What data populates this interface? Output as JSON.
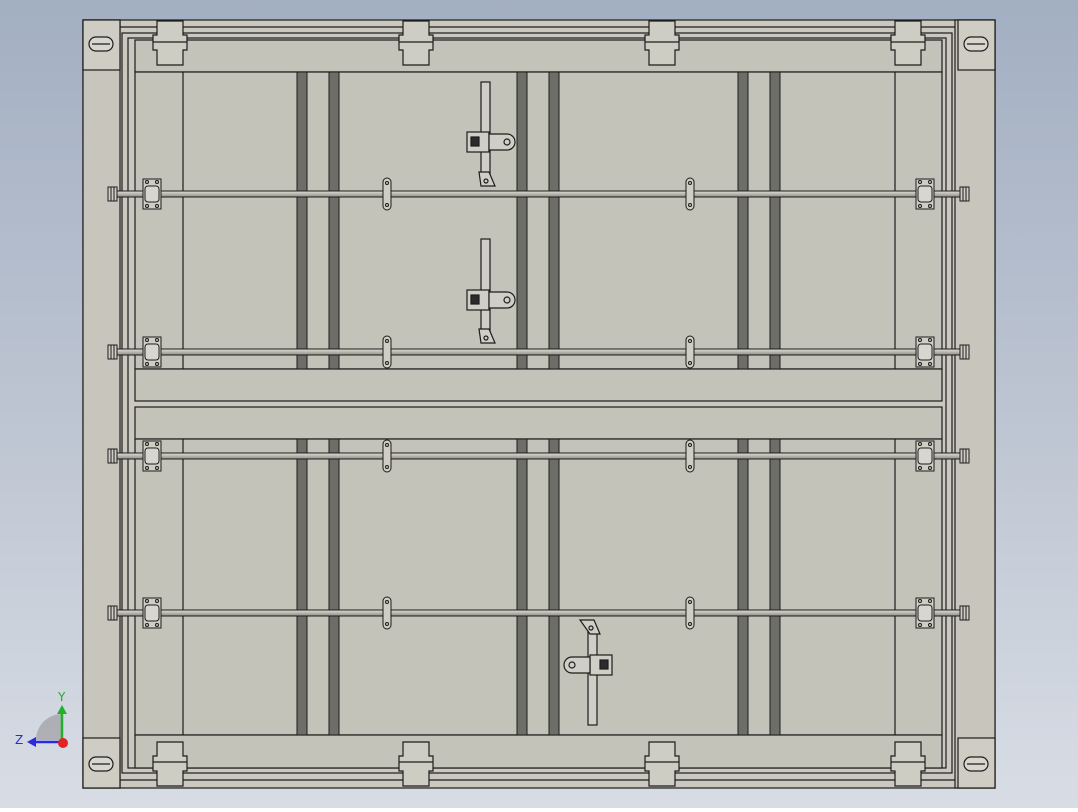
{
  "app": {
    "window_title": ""
  },
  "colors": {
    "background_top": "#a3afc2",
    "background_bottom": "#d8dde5",
    "panel": "#c4c3b9",
    "frame": "#cbc9bf",
    "outline": "#1c1c1c",
    "corrugation": "#6e6e69",
    "axis_x": "#e32222",
    "axis_y": "#22b02b",
    "axis_z": "#2a2ae0"
  },
  "model": {
    "description_icons": [
      "container-door-frame-icon",
      "locking-bar-icon",
      "door-handle-icon",
      "hinge-icon",
      "corner-casting-icon"
    ]
  },
  "triad": {
    "y_label": "Y",
    "z_label": "Z"
  }
}
